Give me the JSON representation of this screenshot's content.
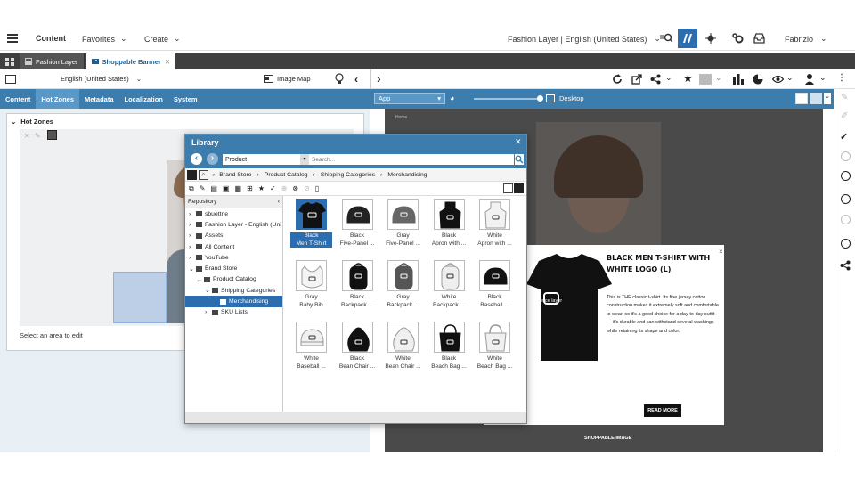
{
  "topbar": {
    "section": "Content",
    "favorites": "Favorites",
    "create": "Create",
    "site_selector": "Fashion Layer | English (United States)",
    "user": "Fabrizio"
  },
  "tabs": [
    {
      "label": "Fashion Layer"
    },
    {
      "label": "Shoppable Banner"
    }
  ],
  "editor": {
    "locale": "English (United States)",
    "image_map": "Image Map",
    "form_tabs": [
      "Content",
      "Hot Zones",
      "Metadata",
      "Localization",
      "System"
    ],
    "hot_zones_title": "Hot Zones",
    "hint": "Select an area to edit"
  },
  "preview": {
    "mode_select": "App",
    "device": "Desktop",
    "breadcrumb": "Home",
    "product_title": "BLACK MEN T-SHIRT WITH WHITE LOGO (L)",
    "brand_text": "commerce layer",
    "product_desc": "This is THE classic t-shirt. Its fine jersey cotton construction makes it extremely soft and comfortable to wear, so it's a good choice for a day-to-day outfit — it's durable and can withstand several washings while retaining its shape and color.",
    "read_more": "READ MORE",
    "caption": "SHOPPABLE IMAGE"
  },
  "library": {
    "title": "Library",
    "type_filter": "Product",
    "search_placeholder": "Search...",
    "breadcrumb": [
      "Brand Store",
      "Product Catalog",
      "Shipping Categories",
      "Merchandising"
    ],
    "repository_label": "Repository",
    "tree": [
      {
        "label": "sbuettne",
        "depth": 0,
        "icon": "home-icon"
      },
      {
        "label": "Fashion Layer - English (Uni",
        "depth": 0,
        "icon": "globe-icon"
      },
      {
        "label": "Assets",
        "depth": 0,
        "icon": "assets-icon"
      },
      {
        "label": "All Content",
        "depth": 0,
        "icon": "folder-icon"
      },
      {
        "label": "YouTube",
        "depth": 0,
        "icon": "folder-icon"
      },
      {
        "label": "Brand Store",
        "depth": 0,
        "icon": "store-icon"
      },
      {
        "label": "Product Catalog",
        "depth": 1,
        "icon": "catalog-icon"
      },
      {
        "label": "Shipping Categories",
        "depth": 2,
        "icon": "list-icon"
      },
      {
        "label": "Merchandising",
        "depth": 3,
        "icon": "list-icon"
      },
      {
        "label": "SKU Lists",
        "depth": 2,
        "icon": "list-icon"
      }
    ],
    "items": [
      {
        "l1": "Black",
        "l2": "Men T-Shirt",
        "kind": "tshirt",
        "color": "#111111",
        "selected": true
      },
      {
        "l1": "Black",
        "l2": "Five-Panel ...",
        "kind": "cap",
        "color": "#222222"
      },
      {
        "l1": "Gray",
        "l2": "Five-Panel ...",
        "kind": "cap",
        "color": "#666666"
      },
      {
        "l1": "Black",
        "l2": "Apron with ...",
        "kind": "apron",
        "color": "#111111"
      },
      {
        "l1": "White",
        "l2": "Apron with ...",
        "kind": "apron",
        "color": "#f2f2f2"
      },
      {
        "l1": "Gray",
        "l2": "Baby Bib",
        "kind": "bib",
        "color": "#f4f4f4"
      },
      {
        "l1": "Black",
        "l2": "Backpack ...",
        "kind": "backpack",
        "color": "#111111"
      },
      {
        "l1": "Gray",
        "l2": "Backpack ...",
        "kind": "backpack",
        "color": "#555555"
      },
      {
        "l1": "White",
        "l2": "Backpack ...",
        "kind": "backpack",
        "color": "#eeeeee"
      },
      {
        "l1": "Black",
        "l2": "Baseball ...",
        "kind": "cap",
        "color": "#111111"
      },
      {
        "l1": "White",
        "l2": "Baseball ...",
        "kind": "cap",
        "color": "#f0f0f0"
      },
      {
        "l1": "Black",
        "l2": "Bean Chair ...",
        "kind": "beanbag",
        "color": "#111111"
      },
      {
        "l1": "White",
        "l2": "Bean Chair ...",
        "kind": "beanbag",
        "color": "#f0f0f0"
      },
      {
        "l1": "Black",
        "l2": "Beach Bag ...",
        "kind": "bag",
        "color": "#111111"
      },
      {
        "l1": "White",
        "l2": "Beach Bag ...",
        "kind": "bag",
        "color": "#f0f0f0"
      }
    ]
  },
  "colors": {
    "accent": "#3c7dad",
    "selection": "#2c6db0",
    "tabstrip": "#3f3f3f"
  }
}
